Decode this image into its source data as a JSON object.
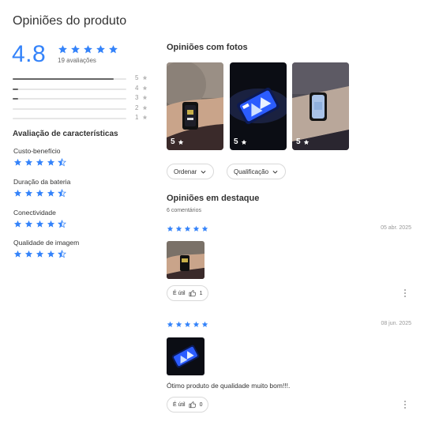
{
  "header": {
    "title": "Opiniões do produto"
  },
  "summary": {
    "rating": "4.8",
    "rating_value": 4.8,
    "reviews_count": "19 avaliações",
    "distribution": [
      {
        "label": "5",
        "fraction": 0.89
      },
      {
        "label": "4",
        "fraction": 0.05
      },
      {
        "label": "3",
        "fraction": 0.05
      },
      {
        "label": "2",
        "fraction": 0.0
      },
      {
        "label": "1",
        "fraction": 0.0
      }
    ]
  },
  "characteristics": {
    "title": "Avaliação de características",
    "items": [
      {
        "label": "Custo-benefício",
        "rating": 4.5
      },
      {
        "label": "Duração da bateria",
        "rating": 4.5
      },
      {
        "label": "Conectividade",
        "rating": 4.5
      },
      {
        "label": "Qualidade de imagem",
        "rating": 4.5
      }
    ]
  },
  "photos": {
    "title": "Opiniões com fotos",
    "items": [
      {
        "rating": "5"
      },
      {
        "rating": "5"
      },
      {
        "rating": "5"
      }
    ]
  },
  "filters": {
    "order": "Ordenar",
    "rating": "Qualificação"
  },
  "featured": {
    "title": "Opiniões em destaque",
    "count": "6 comentários",
    "reviews": [
      {
        "stars": 5,
        "date": "05 abr. 2025",
        "text": "",
        "useful_label": "É útil",
        "useful_count": "1"
      },
      {
        "stars": 5,
        "date": "08 jun. 2025",
        "text": "Ótimo produto de qualidade muito bom!!!.",
        "useful_label": "É útil",
        "useful_count": "0"
      }
    ]
  },
  "colors": {
    "accent": "#3483fa",
    "text": "#333333",
    "muted": "#999999"
  },
  "icons": {
    "star": "star-icon",
    "chevron": "chevron-down-icon",
    "thumb": "thumbs-up-icon",
    "more": "more-vertical-icon"
  }
}
